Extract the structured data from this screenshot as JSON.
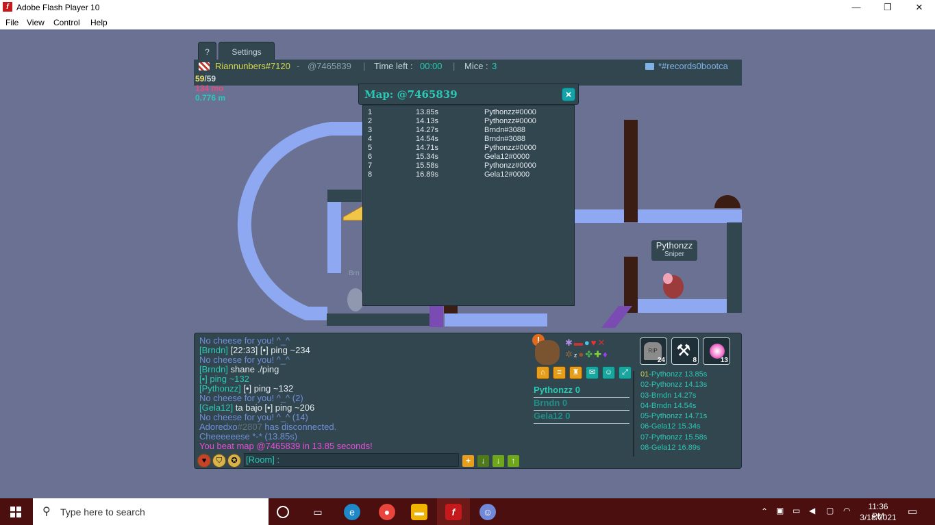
{
  "window": {
    "title": "Adobe Flash Player 10",
    "logo": "f",
    "minimize": "—",
    "maximize": "❐",
    "close": "✕"
  },
  "menu": [
    "File",
    "View",
    "Control",
    "Help"
  ],
  "tabs": {
    "help": "?",
    "settings": "Settings"
  },
  "hud": {
    "player": "Riannunbers#7120",
    "map_sep": " - ",
    "map": "@7465839",
    "time_label": "Time left :",
    "time": "00:00",
    "mice_label": "Mice :",
    "mice": "3",
    "room": "*#records0bootca"
  },
  "stats": {
    "fps": "59",
    "fps_max": "/59",
    "mo": "134 mo",
    "m": "0.776 m"
  },
  "nametag": {
    "name": "Pythonzz",
    "title": "Sniper"
  },
  "ghost_label": "Brn",
  "popup": {
    "title": "Map: @7465839",
    "close": "×",
    "rows": [
      {
        "rank": "1",
        "time": "13.85s",
        "player": "Pythonzz#0000"
      },
      {
        "rank": "2",
        "time": "14.13s",
        "player": "Pythonzz#0000"
      },
      {
        "rank": "3",
        "time": "14.27s",
        "player": "Brndn#3088"
      },
      {
        "rank": "4",
        "time": "14.54s",
        "player": "Brndn#3088"
      },
      {
        "rank": "5",
        "time": "14.71s",
        "player": "Pythonzz#0000"
      },
      {
        "rank": "6",
        "time": "15.34s",
        "player": "Gela12#0000"
      },
      {
        "rank": "7",
        "time": "15.58s",
        "player": "Pythonzz#0000"
      },
      {
        "rank": "8",
        "time": "16.89s",
        "player": "Gela12#0000"
      }
    ]
  },
  "chat": [
    {
      "parts": [
        {
          "t": "No cheese for you! ^_^",
          "c": "#6f8fd8"
        }
      ]
    },
    {
      "parts": [
        {
          "t": "[Brndn]",
          "c": "#29c9b5"
        },
        {
          "t": " [22:33] [•] ping ~234",
          "c": "#e4ebee"
        }
      ]
    },
    {
      "parts": [
        {
          "t": "No cheese for you! ^_^",
          "c": "#6f8fd8"
        }
      ]
    },
    {
      "parts": [
        {
          "t": "[Brndn]",
          "c": "#29c9b5"
        },
        {
          "t": " shane ./ping",
          "c": "#e4ebee"
        }
      ]
    },
    {
      "parts": [
        {
          "t": "[•] ping ~132",
          "c": "#29c9b5"
        }
      ]
    },
    {
      "parts": [
        {
          "t": "[Pythonzz]",
          "c": "#29c9b5"
        },
        {
          "t": " [•] ping ~132",
          "c": "#e4ebee"
        }
      ]
    },
    {
      "parts": [
        {
          "t": "No cheese for you! ^_^ (2)",
          "c": "#6f8fd8"
        }
      ]
    },
    {
      "parts": [
        {
          "t": "[Gela12]",
          "c": "#29c9b5"
        },
        {
          "t": " ta bajo [•] ping ~206",
          "c": "#e4ebee"
        }
      ]
    },
    {
      "parts": [
        {
          "t": "No cheese for you! ^_^ (14)",
          "c": "#6f8fd8"
        }
      ]
    },
    {
      "parts": [
        {
          "t": "Adoredxo",
          "c": "#6f8fd8"
        },
        {
          "t": "#2807",
          "c": "#5e7280"
        },
        {
          "t": " has disconnected.",
          "c": "#6f8fd8"
        }
      ]
    },
    {
      "parts": [
        {
          "t": "Cheeeeeese *-* (13.85s)",
          "c": "#6f8fd8"
        }
      ]
    },
    {
      "parts": [
        {
          "t": "You beat map @7465839 in 13.85 seconds!",
          "c": "#e84cd8"
        }
      ]
    }
  ],
  "chat_input": "[Room] :",
  "scoreboard": [
    {
      "name": "Pythonzz",
      "score": "0",
      "color": "#29c9b5"
    },
    {
      "name": "Brndn",
      "score": "0",
      "color": "#1f8f87"
    },
    {
      "name": "Gela12",
      "score": "0",
      "color": "#1f8f87"
    }
  ],
  "times": [
    {
      "rank": "01",
      "text": "-Pythonzz 13.85s"
    },
    {
      "rank": "02",
      "text": "-Pythonzz 14.13s"
    },
    {
      "rank": "03",
      "text": "-Brndn 14.27s"
    },
    {
      "rank": "04",
      "text": "-Brndn 14.54s"
    },
    {
      "rank": "05",
      "text": "-Pythonzz 14.71s"
    },
    {
      "rank": "06",
      "text": "-Gela12 15.34s"
    },
    {
      "rank": "07",
      "text": "-Pythonzz 15.58s"
    },
    {
      "rank": "08",
      "text": "-Gela12 16.89s"
    }
  ],
  "cards": [
    {
      "icon": "tombstone-icon",
      "count": "24",
      "glyph": "RIP"
    },
    {
      "icon": "hammer-icon",
      "count": "8",
      "glyph": "⚒"
    },
    {
      "icon": "energy-orb-icon",
      "count": "13",
      "glyph": "✦"
    }
  ],
  "taskbar": {
    "search_placeholder": "Type here to search",
    "time": "11:36 PM",
    "date": "3/18/2021"
  },
  "colors": {
    "accent": "#29c9b5",
    "platform": "#8ea8f2",
    "panel": "#324650",
    "taskbar": "#4a0f0e"
  }
}
